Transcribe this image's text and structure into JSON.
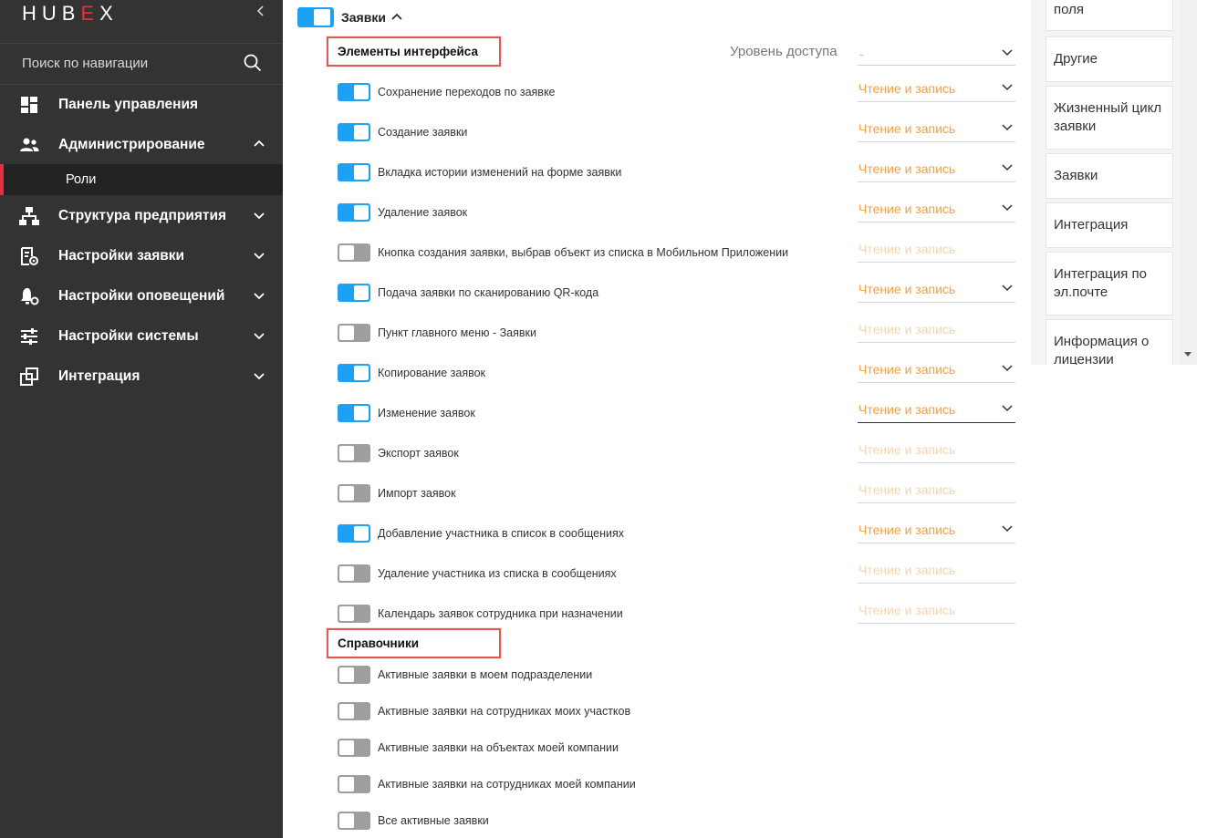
{
  "sidebar": {
    "logo_text": "HUB",
    "logo_e": "E",
    "logo_x": "X",
    "search_placeholder": "Поиск по навигации",
    "items": [
      {
        "label": "Панель управления",
        "icon": "dashboard-icon"
      },
      {
        "label": "Администрирование",
        "icon": "users-icon"
      },
      {
        "label": "Структура предприятия",
        "icon": "org-structure-icon"
      },
      {
        "label": "Настройки заявки",
        "icon": "request-settings-icon"
      },
      {
        "label": "Настройки оповещений",
        "icon": "notification-settings-icon"
      },
      {
        "label": "Настройки системы",
        "icon": "system-settings-icon"
      },
      {
        "label": "Интеграция",
        "icon": "integration-icon"
      }
    ],
    "subitem": "Роли"
  },
  "main": {
    "group_title": "Заявки",
    "section_ui": "Элементы интерфейса",
    "access_label": "Уровень доступа",
    "access_value": "-",
    "section_refs": "Справочники",
    "rows": [
      {
        "label": "Сохранение переходов по заявке",
        "on": true,
        "access": "Чтение и запись"
      },
      {
        "label": "Создание заявки",
        "on": true,
        "access": "Чтение и запись"
      },
      {
        "label": "Вкладка истории изменений на форме заявки",
        "on": true,
        "access": "Чтение и запись"
      },
      {
        "label": "Удаление заявок",
        "on": true,
        "access": "Чтение и запись"
      },
      {
        "label": "Кнопка создания заявки, выбрав объект из списка в Мобильном Приложении",
        "on": false,
        "access": "Чтение и запись"
      },
      {
        "label": "Подача заявки по сканированию QR-кода",
        "on": true,
        "access": "Чтение и запись"
      },
      {
        "label": "Пункт главного меню - Заявки",
        "on": false,
        "access": "Чтение и запись"
      },
      {
        "label": "Копирование заявок",
        "on": true,
        "access": "Чтение и запись"
      },
      {
        "label": "Изменение заявок",
        "on": true,
        "access": "Чтение и запись"
      },
      {
        "label": "Экспорт заявок",
        "on": false,
        "access": "Чтение и запись"
      },
      {
        "label": "Импорт заявок",
        "on": false,
        "access": "Чтение и запись"
      },
      {
        "label": "Добавление участника в список в сообщениях",
        "on": true,
        "access": "Чтение и запись"
      },
      {
        "label": "Удаление участника из списка в сообщениях",
        "on": false,
        "access": "Чтение и запись"
      },
      {
        "label": "Календарь заявок сотрудника при назначении",
        "on": false,
        "access": "Чтение и запись"
      }
    ],
    "refs": [
      {
        "label": "Активные заявки в моем подразделении",
        "on": false
      },
      {
        "label": "Активные заявки на сотрудниках моих участков",
        "on": false
      },
      {
        "label": "Активные заявки на объектах моей компании",
        "on": false
      },
      {
        "label": "Активные заявки на сотрудниках моей компании",
        "on": false
      },
      {
        "label": "Все активные заявки",
        "on": false
      }
    ]
  },
  "right_tabs": [
    "поля",
    "Другие",
    "Жизненный цикл заявки",
    "Заявки",
    "Интеграция",
    "Интеграция по эл.почте",
    "Информация о лицензии"
  ],
  "colors": {
    "sidebar_bg": "#333333",
    "accent_red": "#e5303f",
    "toggle_on": "#1da1f2",
    "toggle_off": "#9e9e9e",
    "access_text": "#f0a040",
    "access_text_disabled": "#f6d4ad"
  }
}
